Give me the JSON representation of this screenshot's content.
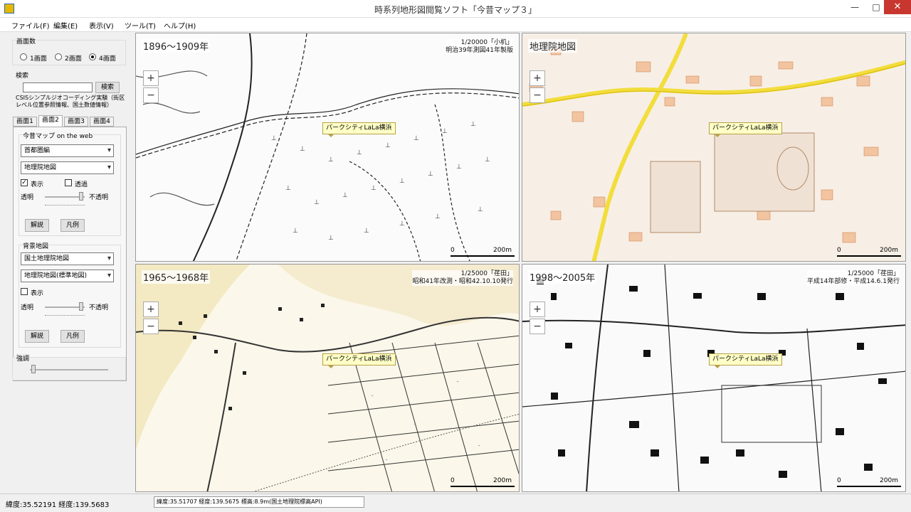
{
  "window": {
    "title": "時系列地形図閲覧ソフト「今昔マップ３」",
    "minimize": "—",
    "maximize": "□",
    "close": "✕",
    "app_icon": "map-app-icon"
  },
  "menu": [
    "ファイル(F)",
    "編集(E)",
    "表示(V)",
    "ツール(T)",
    "ヘルプ(H)"
  ],
  "left": {
    "screen_count": {
      "label": "画面数",
      "options": [
        "1画面",
        "2画面",
        "4画面"
      ],
      "selected": "4画面"
    },
    "search": {
      "label": "検索",
      "value": "",
      "button": "検索",
      "note_line1": "CSISシンプルジオコーディング実験（街区",
      "note_line2": "レベル位置参照情報、国土数値情報）"
    },
    "tabs": [
      "画面1",
      "画面2",
      "画面3",
      "画面4"
    ],
    "active_tab": "画面2",
    "konjaku": {
      "label": "今昔マップ on the web",
      "region": "首都圏編",
      "layer": "地理院地図",
      "show_label": "表示",
      "show_checked": true,
      "transparent_label": "透過",
      "transparent_checked": false,
      "opacity_left": "透明",
      "opacity_right": "不透明",
      "btn_explain": "解説",
      "btn_legend": "凡例"
    },
    "background": {
      "label": "背景地図",
      "source": "国土地理院地図",
      "layer": "地理院地図(標準地図)",
      "show_label": "表示",
      "show_checked": false,
      "opacity_left": "透明",
      "opacity_right": "不透明",
      "btn_explain": "解説",
      "btn_legend": "凡例"
    },
    "emphasis": {
      "label": "強調"
    }
  },
  "panes": [
    {
      "label": "1896～1909年",
      "info_line1": "1/20000「小机」",
      "info_line2": "明治39年測図41年製版",
      "marker": "パークシティLaLa横浜",
      "scale_left": "0",
      "scale_right": "200m",
      "zoom_in": "+",
      "zoom_out": "−"
    },
    {
      "label": "地理院地図",
      "info_line1": "",
      "info_line2": "",
      "marker": "パークシティLaLa横浜",
      "scale_left": "0",
      "scale_right": "200m",
      "zoom_in": "+",
      "zoom_out": "−"
    },
    {
      "label": "1965～1968年",
      "info_line1": "1/25000「荏田」",
      "info_line2": "昭和41年改測・昭和42.10.10発行",
      "marker": "パークシティLaLa横浜",
      "scale_left": "0",
      "scale_right": "200m",
      "zoom_in": "+",
      "zoom_out": "−"
    },
    {
      "label": "1998～2005年",
      "info_line1": "1/25000「荏田」",
      "info_line2": "平成14年部修・平成14.6.1発行",
      "marker": "パークシティLaLa横浜",
      "scale_left": "0",
      "scale_right": "200m",
      "zoom_in": "+",
      "zoom_out": "−"
    }
  ],
  "status": {
    "left": "緯度:35.52191 経度:139.5683",
    "right": "緯度:35.51707 経度:139.5675 標高:8.9m(国土地理院標高API)"
  }
}
